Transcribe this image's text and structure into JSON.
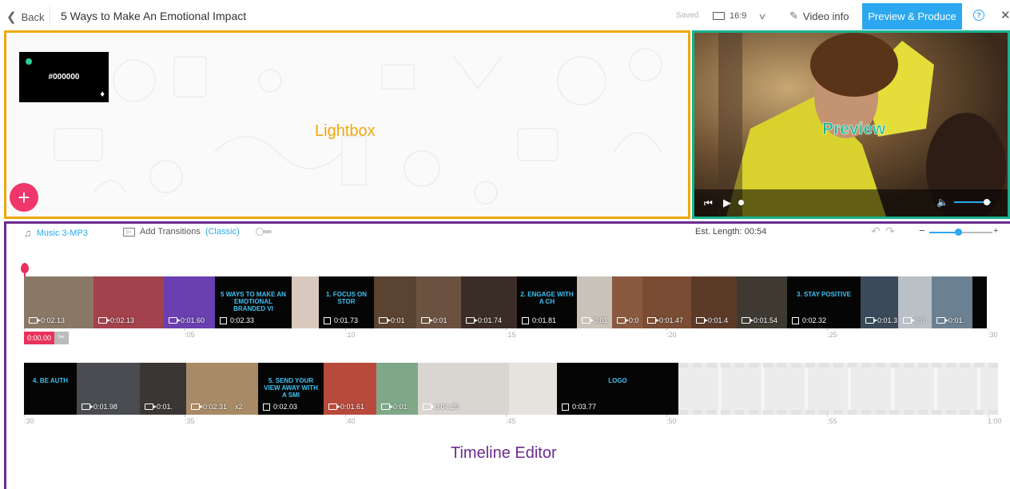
{
  "header": {
    "back_label": "Back",
    "project_title": "5 Ways to Make An Emotional Impact",
    "saved_status": "Saved",
    "aspect_ratio": "16:9",
    "video_info_label": "Video info",
    "produce_label": "Preview & Produce",
    "help_icon": "question-icon",
    "close_icon": "close-icon"
  },
  "lightbox": {
    "label": "Lightbox",
    "color_tile": {
      "hex": "#000000"
    },
    "add_button_icon": "plus-icon"
  },
  "preview": {
    "label": "Preview",
    "volume_level": 0.8
  },
  "timeline": {
    "label": "Timeline Editor",
    "music_label": "Music 3-MP3",
    "add_transitions_label": "Add Transitions",
    "transitions_mode": "(Classic)",
    "est_length_label": "Est. Length: 00:54",
    "zoom_level": 0.45,
    "playhead_time": "0:00.00",
    "track1": [
      {
        "dur": "0:02.13",
        "kind": "video",
        "color": "#8a7866"
      },
      {
        "dur": "0:02.13",
        "kind": "video",
        "color": "#a3414c"
      },
      {
        "dur": "0:01.60",
        "kind": "video",
        "color": "#6a3fb0"
      },
      {
        "dur": "0:02.33",
        "kind": "title",
        "color": "#050505",
        "text": "5 WAYS TO MAKE AN EMOTIONAL BRANDED VI"
      },
      {
        "dur": "",
        "kind": "video",
        "color": "#d9c8be"
      },
      {
        "dur": "0:01.73",
        "kind": "title",
        "color": "#050505",
        "text": "1. FOCUS ON STOR"
      },
      {
        "dur": "0:01",
        "kind": "video",
        "color": "#5a4330"
      },
      {
        "dur": "0:01",
        "kind": "video",
        "color": "#6b5240"
      },
      {
        "dur": "0:01.74",
        "kind": "video",
        "color": "#3a2c26"
      },
      {
        "dur": "0:01.81",
        "kind": "title",
        "color": "#050505",
        "text": "2. ENGAGE WITH A CH"
      },
      {
        "dur": "0:01",
        "kind": "video",
        "color": "#c9c2b8"
      },
      {
        "dur": "0:0",
        "kind": "video",
        "color": "#8a5a40"
      },
      {
        "dur": "0:01.47",
        "kind": "video",
        "color": "#7a4c34"
      },
      {
        "dur": "0:01.4",
        "kind": "video",
        "color": "#5c3a28"
      },
      {
        "dur": "0:01.54",
        "kind": "video",
        "color": "#3e3a32"
      },
      {
        "dur": "0:02.32",
        "kind": "title",
        "color": "#050505",
        "text": "3. STAY POSITIVE"
      },
      {
        "dur": "0:01.3",
        "kind": "video",
        "color": "#3a4a5a"
      },
      {
        "dur": "0:0",
        "kind": "video",
        "color": "#b9c0c6"
      },
      {
        "dur": "0:01.",
        "kind": "video",
        "color": "#6b8090"
      },
      {
        "dur": "",
        "kind": "title",
        "color": "#050505",
        "text": ""
      }
    ],
    "track2": [
      {
        "dur": "",
        "kind": "title",
        "color": "#050505",
        "text": "4. BE AUTH"
      },
      {
        "dur": "0:01.98",
        "kind": "video",
        "color": "#4a4c52"
      },
      {
        "dur": "0:01.",
        "kind": "video",
        "color": "#3a3634"
      },
      {
        "dur": "0:02.31",
        "kind": "video",
        "color": "#a88a66",
        "extra": "x2"
      },
      {
        "dur": "0:02.03",
        "kind": "title",
        "color": "#050505",
        "text": "5. SEND YOUR VIEW AWAY WITH A SMI"
      },
      {
        "dur": "0:01.61",
        "kind": "video",
        "color": "#b84a3c"
      },
      {
        "dur": "0:01.",
        "kind": "video",
        "color": "#7fa888"
      },
      {
        "dur": "0:04.25",
        "kind": "video",
        "color": "#d9d6d2"
      },
      {
        "dur": "",
        "kind": "video",
        "color": "#e6e2de"
      },
      {
        "dur": "0:03.77",
        "kind": "title",
        "color": "#050505",
        "text": "LOGO"
      },
      {
        "dur": "",
        "kind": "empty",
        "color": ""
      }
    ],
    "ruler1": [
      "",
      ":05",
      ":10",
      ":15",
      ":20",
      ":25",
      ":30"
    ],
    "ruler2": [
      ":30",
      ":35",
      ":40",
      ":45",
      ":50",
      ":55",
      "1:00"
    ]
  }
}
